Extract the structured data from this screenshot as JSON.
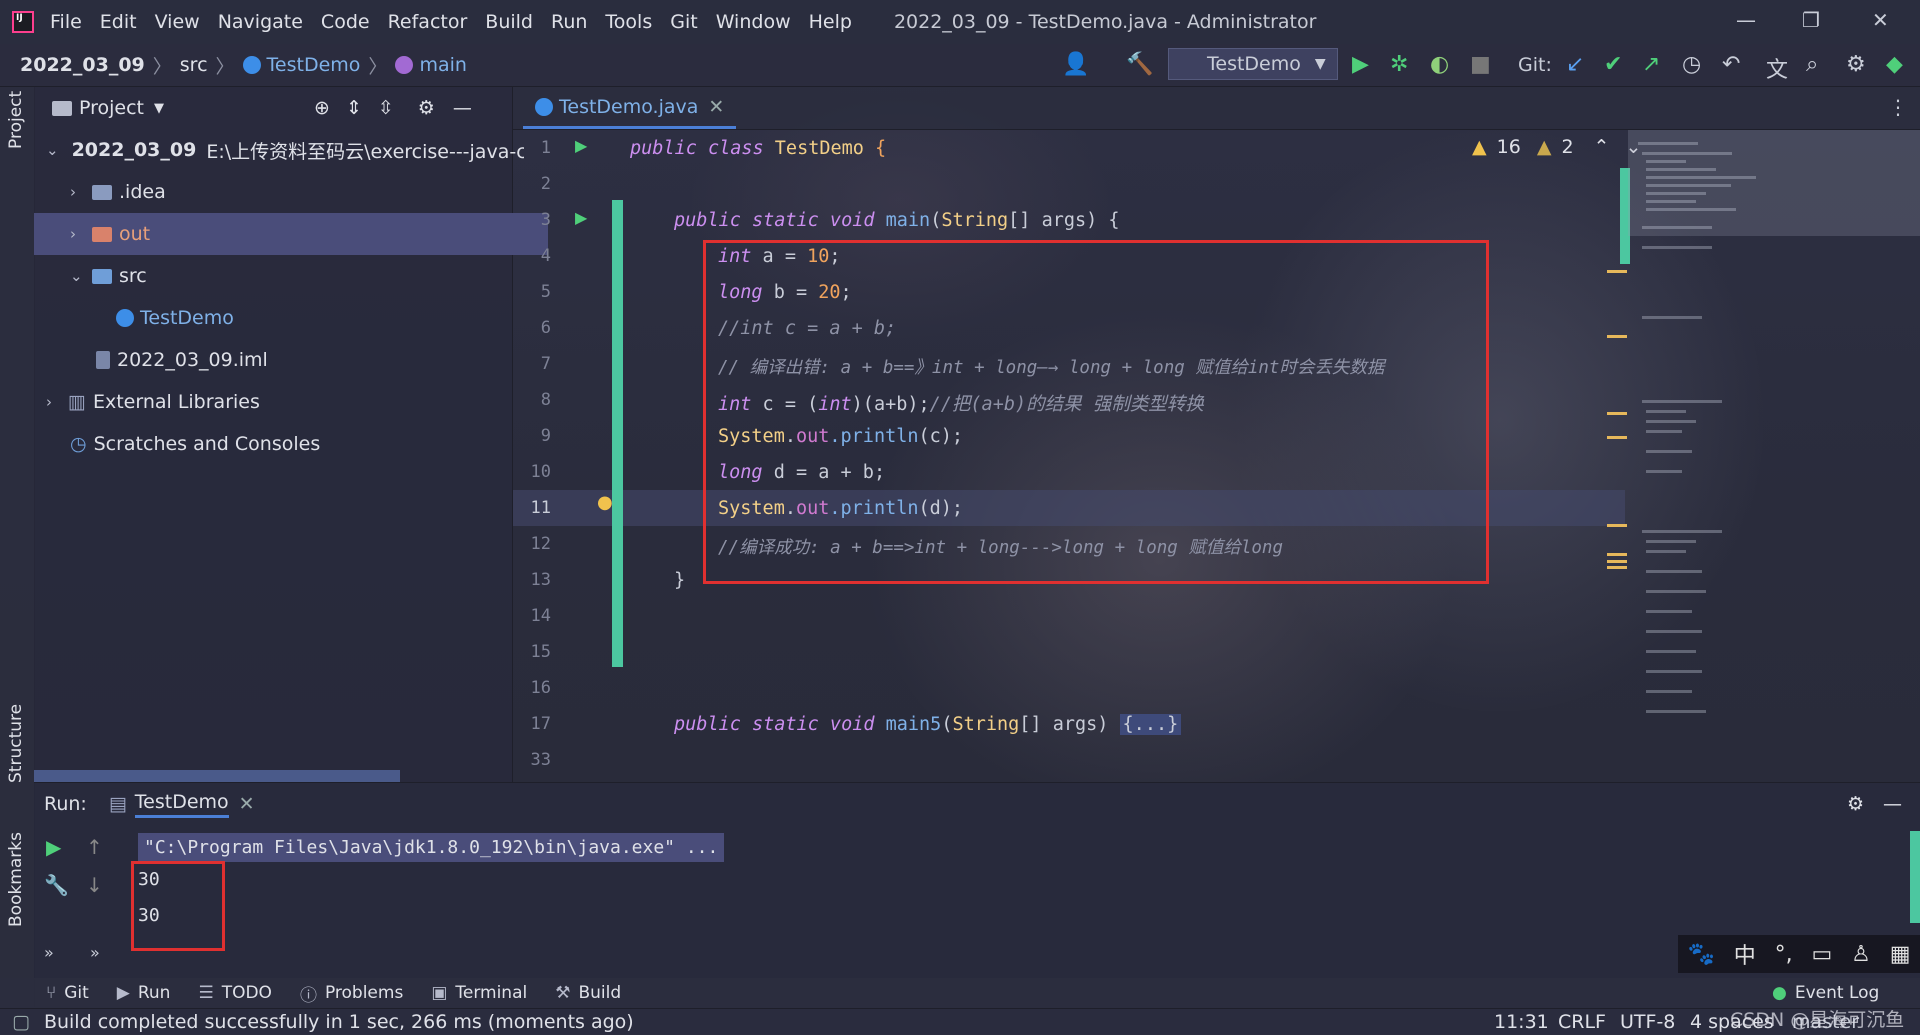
{
  "menu": {
    "items": [
      "File",
      "Edit",
      "View",
      "Navigate",
      "Code",
      "Refactor",
      "Build",
      "Run",
      "Tools",
      "Git",
      "Window",
      "Help"
    ],
    "window_title": "2022_03_09 - TestDemo.java - Administrator"
  },
  "nav": {
    "project": "2022_03_09",
    "src": "src",
    "class": "TestDemo",
    "method": "main",
    "run_config": "TestDemo",
    "git_label": "Git:"
  },
  "project_panel": {
    "title": "Project",
    "root_name": "2022_03_09",
    "root_path": "E:\\上传资料至码云\\exercise---java-co",
    "items": [
      ".idea",
      "out",
      "src",
      "TestDemo",
      "2022_03_09.iml",
      "External Libraries",
      "Scratches and Consoles"
    ]
  },
  "editor": {
    "tab": "TestDemo.java",
    "warnings": "16",
    "weak_warnings": "2",
    "line_numbers": [
      "1",
      "2",
      "3",
      "4",
      "5",
      "6",
      "7",
      "8",
      "9",
      "10",
      "11",
      "12",
      "13",
      "14",
      "15",
      "16",
      "17",
      "33"
    ]
  },
  "code": {
    "l1_kw": "public class ",
    "l1_cls": "TestDemo",
    "l1_rest": " {",
    "l3_kw": "public static void ",
    "l3_fn": "main",
    "l3_cls": "String",
    "l3_rest": "[] args) {",
    "l4_kw": "int",
    "l4_mid": " a = ",
    "l4_num": "10",
    "l4_end": ";",
    "l5_kw": "long",
    "l5_mid": " b = ",
    "l5_num": "20",
    "l5_end": ";",
    "l6_cmt": "//int c = a + b;",
    "l7_cmt": "// 编译出错: a + b==》int + long—→ long + long 赋值给int时会丢失数据",
    "l8_kw": "int",
    "l8_mid": " c = (",
    "l8_kw2": "int",
    "l8_rest": ")(a+b);",
    "l8_cmt": "//把(a+b)的结果 强制类型转换",
    "l9_cls": "System",
    "l9_dot": ".",
    "l9_fld": "out",
    "l9_fn": ".println",
    "l9_rest": "(c);",
    "l10_kw": "long",
    "l10_rest": " d = a + b;",
    "l11_cls": "System",
    "l11_dot": ".",
    "l11_fld": "out",
    "l11_fn": ".println",
    "l11_rest": "(d);",
    "l12_cmt": "//编译成功: a + b==>int + long--->long + long 赋值给long",
    "l13": "}",
    "l17_kw": "public static void ",
    "l17_fn": "main5",
    "l17_cls": "String",
    "l17_rest": "[] args) ",
    "l17_fold": "{...}"
  },
  "run_panel": {
    "label": "Run:",
    "tab": "TestDemo",
    "command": "\"C:\\Program Files\\Java\\jdk1.8.0_192\\bin\\java.exe\" ...",
    "output": [
      "30",
      "30"
    ]
  },
  "bottom_tabs": [
    "Git",
    "Run",
    "TODO",
    "Problems",
    "Terminal",
    "Build"
  ],
  "event_log": "Event Log",
  "status": {
    "message": "Build completed successfully in 1 sec, 266 ms (moments ago)",
    "position": "11:31",
    "line_sep": "CRLF",
    "encoding": "UTF-8",
    "indent": "4 spaces",
    "branch": "master",
    "watermark": "CSDN @星海可沉鱼"
  },
  "side_labels": {
    "project": "Project",
    "structure": "Structure",
    "bookmarks": "Bookmarks"
  },
  "ime": {
    "lang": "中"
  }
}
